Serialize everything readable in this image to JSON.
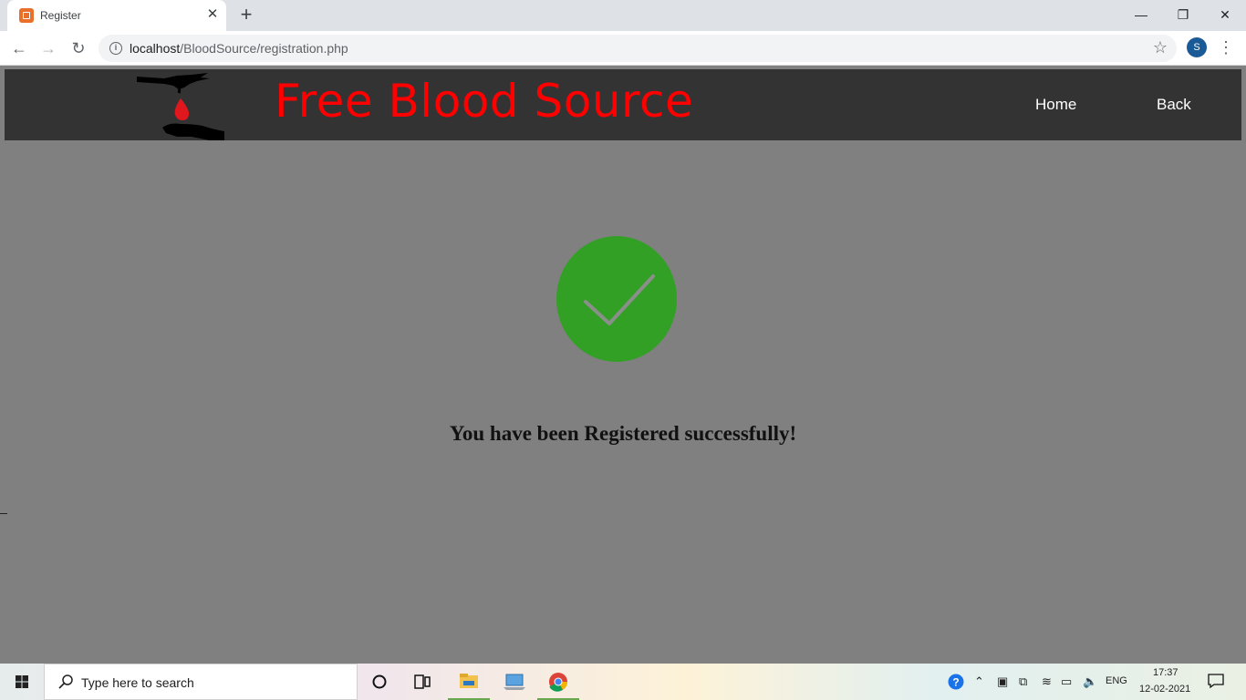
{
  "browser": {
    "tab_title": "Register",
    "url_host": "localhost",
    "url_path": "/BloodSource/registration.php",
    "profile_initial": "S",
    "icons": [
      "close-icon",
      "plus-icon",
      "back-icon",
      "forward-icon",
      "reload-icon",
      "info-icon",
      "star-icon",
      "menu-icon"
    ]
  },
  "site": {
    "brand": "Free Blood Source",
    "nav": {
      "home": "Home",
      "back": "Back"
    },
    "success_message": "You have been Registered successfully!",
    "colors": {
      "navbar": "#333333",
      "brand": "#ff0000",
      "page_bg": "#808080",
      "success": "#329f25"
    }
  },
  "taskbar": {
    "search_placeholder": "Type here to search",
    "lang": "ENG",
    "time": "17:37",
    "date": "12-02-2021"
  }
}
